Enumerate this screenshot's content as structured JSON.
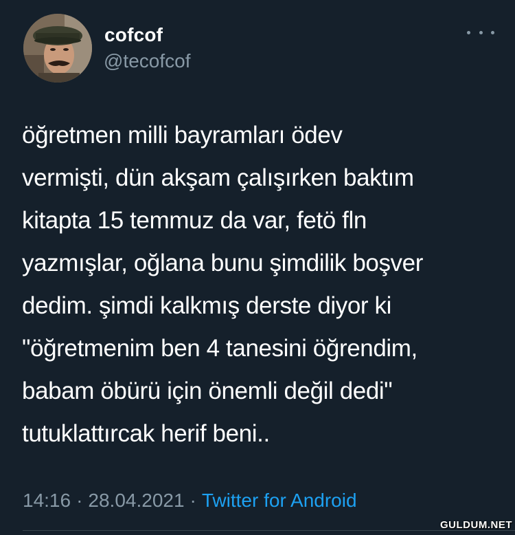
{
  "user": {
    "display_name": "cofcof",
    "handle": "@tecofcof"
  },
  "icons": {
    "avatar": "profile-photo",
    "more": "more-horizontal-icon"
  },
  "tweet": {
    "lines": [
      "öğretmen milli bayramları ödev",
      "vermişti, dün akşam çalışırken baktım",
      "kitapta 15 temmuz da var, fetö fln",
      "yazmışlar, oğlana bunu şimdilik boşver",
      "dedim. şimdi kalkmış derste diyor ki",
      "\"öğretmenim ben 4 tanesini öğrendim,",
      "babam öbürü için önemli değil dedi\"",
      "tutuklattırcak herif beni.."
    ],
    "time": "14:16",
    "separator": "·",
    "date": "28.04.2021",
    "source": "Twitter for Android"
  },
  "watermark": "GULDUM.NET",
  "colors": {
    "background": "#15202b",
    "text": "#ffffff",
    "muted": "#8899a6",
    "link": "#1da1f2",
    "divider": "#38444d"
  }
}
